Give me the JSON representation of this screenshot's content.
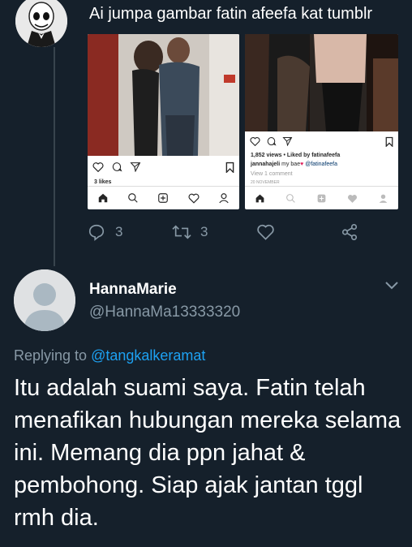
{
  "top_tweet": {
    "text": "Ai jumpa gambar fatin afeefa kat tumblr",
    "images": [
      {
        "likes": "3 likes"
      },
      {
        "views": "1,852 views • Liked by fatinafeefa",
        "caption_user": "jannahajeli",
        "caption_text": "my bae",
        "caption_mention": "@fatinafeefa",
        "comments": "View 1 comment",
        "date": "20 NOVEMBER"
      }
    ],
    "actions": {
      "reply_count": "3",
      "retweet_count": "3"
    }
  },
  "reply_tweet": {
    "display_name": "HannaMarie",
    "handle": "@HannaMa13333320",
    "replying_label": "Replying to",
    "replying_to": "@tangkalkeramat",
    "body": "Itu adalah suami saya. Fatin telah menafikan hubungan mereka selama ini. Memang dia ppn jahat & pembohong. Siap ajak jantan tggl rmh dia."
  },
  "colors": {
    "background": "#15202b",
    "secondary_text": "#8899a6",
    "link": "#1da1f2",
    "divider": "#38444d"
  }
}
